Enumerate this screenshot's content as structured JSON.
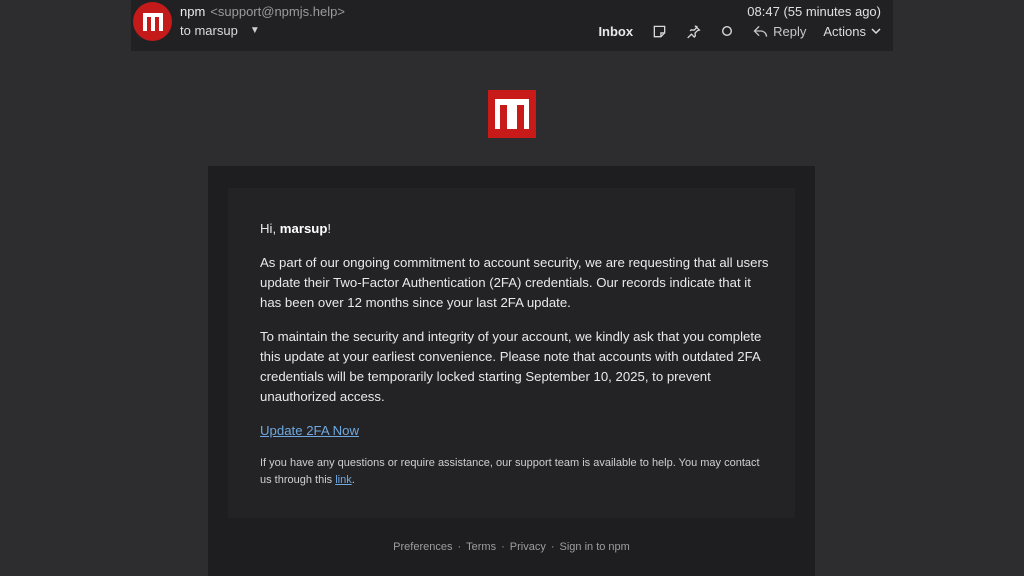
{
  "header": {
    "sender_name": "npm",
    "sender_email": "<support@npmjs.help>",
    "recipient": "to marsup",
    "timestamp": "08:47 (55 minutes ago)",
    "toolbar": {
      "inbox_label": "Inbox",
      "reply_label": "Reply",
      "actions_label": "Actions"
    }
  },
  "email": {
    "greeting_prefix": "Hi, ",
    "greeting_name": "marsup",
    "greeting_suffix": "!",
    "paragraph1": "As part of our ongoing commitment to account security, we are requesting that all users update their Two-Factor Authentication (2FA) credentials. Our records indicate that it has been over 12 months since your last 2FA update.",
    "paragraph2": "To maintain the security and integrity of your account, we kindly ask that you complete this update at your earliest convenience. Please note that accounts with outdated 2FA credentials will be temporarily locked starting September 10, 2025, to prevent unauthorized access.",
    "cta_label": "Update 2FA Now",
    "support_text": "If you have any questions or require assistance, our support team is available to help. You may contact us through this ",
    "support_link": "link",
    "support_end": "."
  },
  "footer": {
    "links": [
      "Preferences",
      "Terms",
      "Privacy",
      "Sign in to npm"
    ],
    "separator": "·"
  },
  "colors": {
    "brand_red": "#c91a1a",
    "link_blue": "#6fa8e0",
    "background": "#2d2d2f"
  },
  "icons": [
    "npm-logo-icon",
    "note-icon",
    "pin-icon",
    "circle-icon",
    "reply-icon",
    "chevron-down-icon"
  ]
}
